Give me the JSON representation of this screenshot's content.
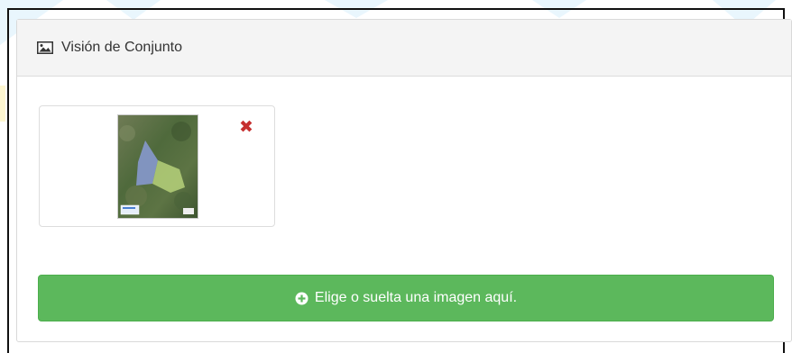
{
  "panel": {
    "title": "Visión de Conjunto",
    "title_icon": "image-icon"
  },
  "thumbnail": {
    "image_description": "map-thumbnail",
    "remove_icon": "close-icon",
    "remove_glyph": "✖"
  },
  "upload_button": {
    "icon": "plus-circle-icon",
    "label": "Elige o suelta una imagen aquí."
  },
  "colors": {
    "upload_green": "#5cb85c",
    "remove_red": "#c62f2f",
    "heading_bg": "#f4f4f4"
  }
}
